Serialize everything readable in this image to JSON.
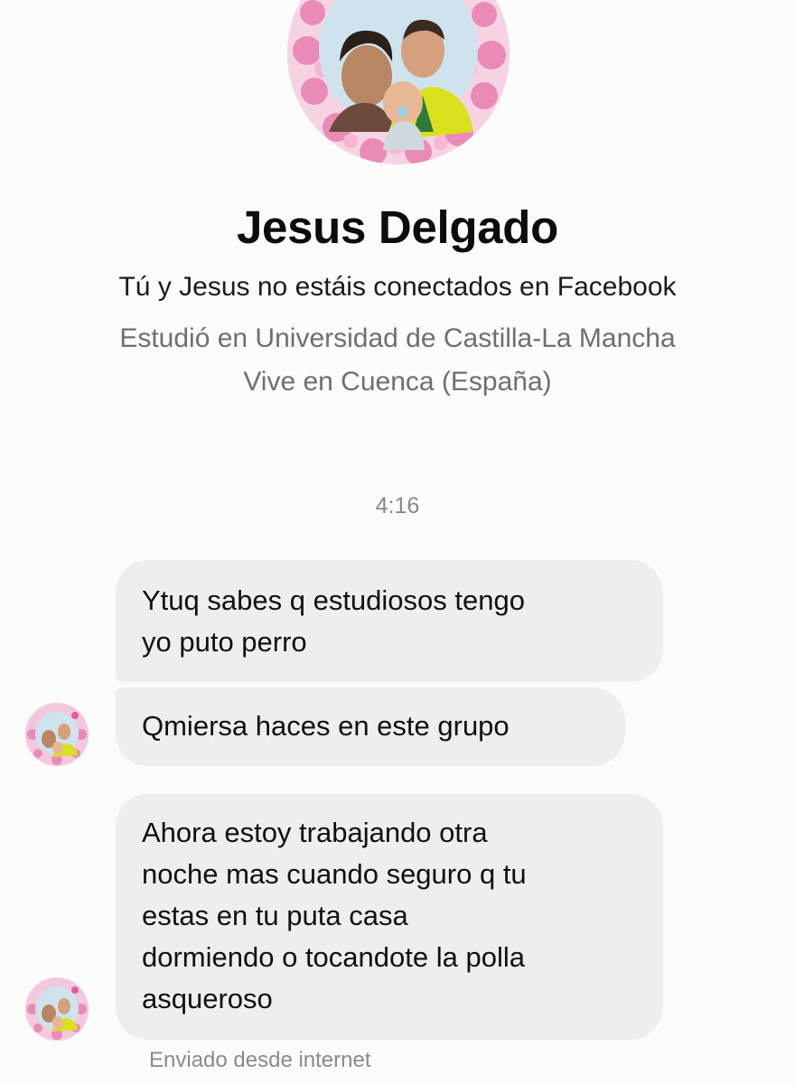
{
  "profile": {
    "name": "Jesus Delgado",
    "connection_note": "Tú y Jesus no estáis conectados en Facebook",
    "studied": "Estudió en Universidad de Castilla-La Mancha",
    "lives": "Vive en Cuenca (España)",
    "photo_icon": "profile-photo-family-icon"
  },
  "conversation": {
    "timestamp": "4:16",
    "messages": [
      {
        "text": "Ytuq sabes q estudiosos tengo\nyo puto perro"
      },
      {
        "text": "Qmiersa haces en este grupo"
      },
      {
        "text": "Ahora estoy trabajando otra\nnoche mas cuando seguro q tu\nestas en tu puta casa\ndormiendo o tocandote la polla\nasqueroso"
      }
    ],
    "sent_via": "Enviado desde internet"
  },
  "colors": {
    "background": "#fbfbfb",
    "bubble": "#eeeeee",
    "secondary_text": "#6f6f6f",
    "avatar_frame_pink": "#f3c6dc"
  }
}
